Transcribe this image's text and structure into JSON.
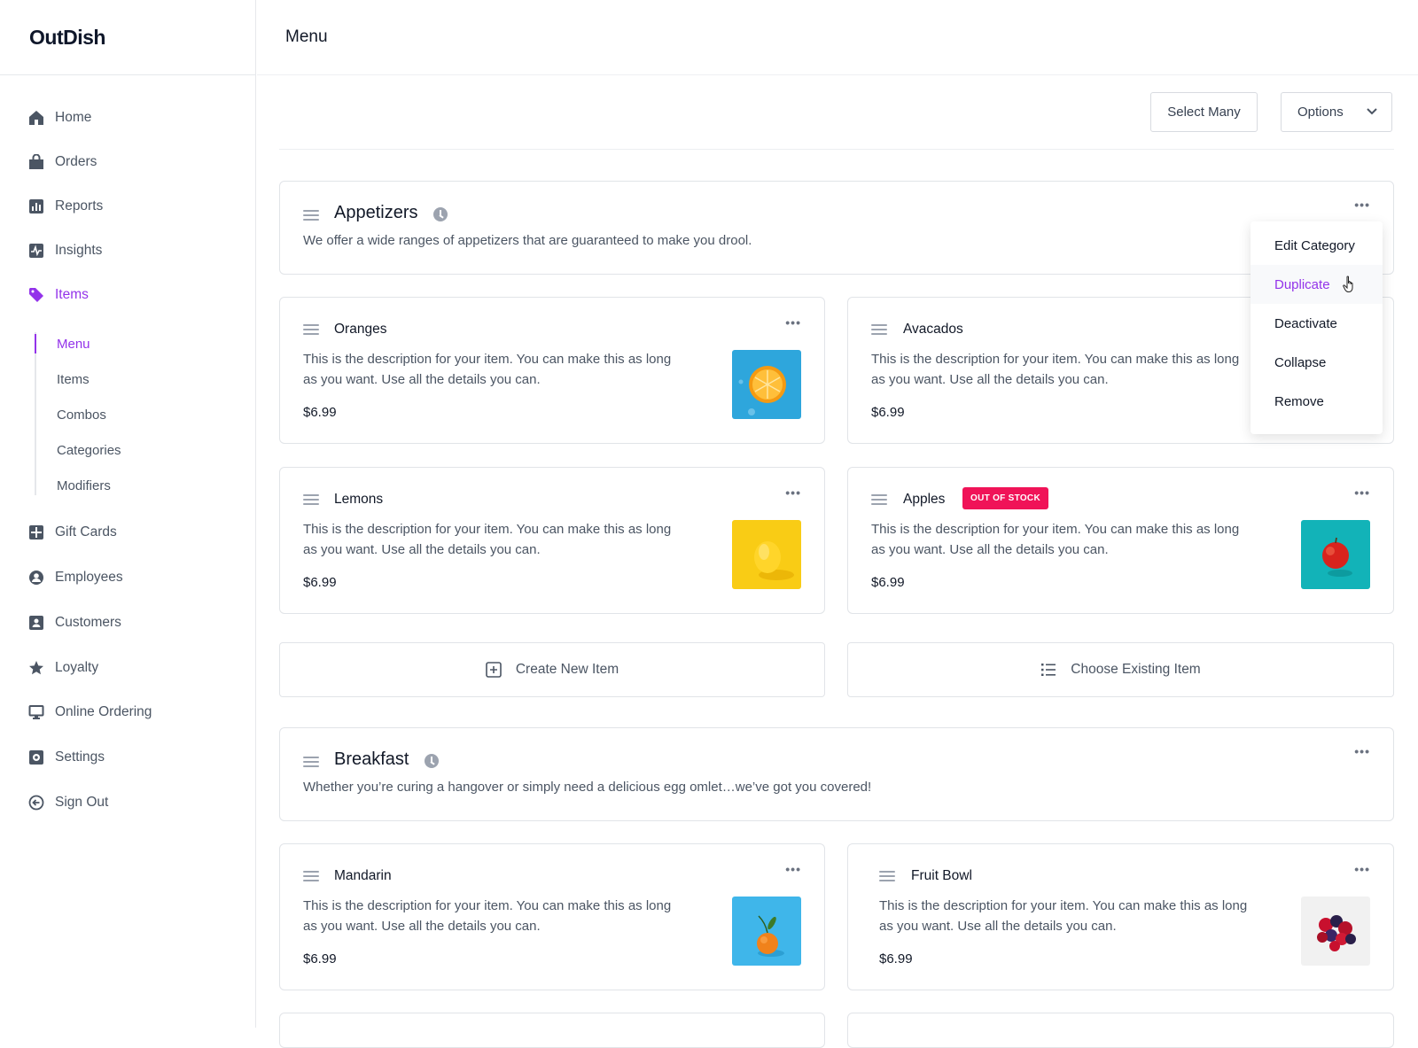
{
  "app": {
    "name": "OutDish"
  },
  "header": {
    "title": "Menu"
  },
  "toolbar": {
    "select_many": "Select Many",
    "options": "Options"
  },
  "sidebar": {
    "items": [
      {
        "label": "Home",
        "icon": "home-icon"
      },
      {
        "label": "Orders",
        "icon": "bag-icon"
      },
      {
        "label": "Reports",
        "icon": "bar-chart-icon"
      },
      {
        "label": "Insights",
        "icon": "pulse-icon"
      },
      {
        "label": "Items",
        "icon": "tag-icon",
        "active": true
      },
      {
        "label": "Gift Cards",
        "icon": "gift-card-icon"
      },
      {
        "label": "Employees",
        "icon": "user-circle-icon"
      },
      {
        "label": "Customers",
        "icon": "contact-card-icon"
      },
      {
        "label": "Loyalty",
        "icon": "star-icon"
      },
      {
        "label": "Online Ordering",
        "icon": "monitor-icon"
      },
      {
        "label": "Settings",
        "icon": "gear-icon"
      },
      {
        "label": "Sign Out",
        "icon": "sign-out-icon"
      }
    ],
    "sub_items": [
      {
        "label": "Menu",
        "active": true
      },
      {
        "label": "Items"
      },
      {
        "label": "Combos"
      },
      {
        "label": "Categories"
      },
      {
        "label": "Modifiers"
      }
    ]
  },
  "categories": [
    {
      "title": "Appetizers",
      "description": "We offer a wide ranges of appetizers that are guaranteed to make you drool.",
      "items": [
        {
          "name": "Oranges",
          "description": "This is the description for your item. You can make this as long as you want. Use all the details you can.",
          "price": "$6.99"
        },
        {
          "name": "Avacados",
          "description": "This is the description for your item. You can make this as long as you want. Use all the details you can.",
          "price": "$6.99"
        },
        {
          "name": "Lemons",
          "description": "This is the description for your item. You can make this as long as you want. Use all the details you can.",
          "price": "$6.99"
        },
        {
          "name": "Apples",
          "badge": "OUT OF STOCK",
          "description": "This is the description for your item. You can make this as long as you want. Use all the details you can.",
          "price": "$6.99"
        }
      ],
      "actions": {
        "create": "Create New Item",
        "choose": "Choose Existing Item"
      }
    },
    {
      "title": "Breakfast",
      "description": "Whether you’re curing a hangover or simply need a delicious egg omlet…we’ve got you covered!",
      "items": [
        {
          "name": "Mandarin",
          "description": "This is the description for your item. You can make this as long as you want. Use all the details you can.",
          "price": "$6.99"
        },
        {
          "name": "Fruit Bowl",
          "description": "This is the description for your item. You can make this as long as you want. Use all the details you can.",
          "price": "$6.99"
        }
      ]
    }
  ],
  "dropdown": {
    "items": [
      "Edit Category",
      "Duplicate",
      "Deactivate",
      "Collapse",
      "Remove"
    ],
    "hovered": "Duplicate"
  },
  "colors": {
    "accent": "#9333ea",
    "badge": "#f01358",
    "border": "#e1e4e8",
    "muted_text": "#4b5563"
  }
}
